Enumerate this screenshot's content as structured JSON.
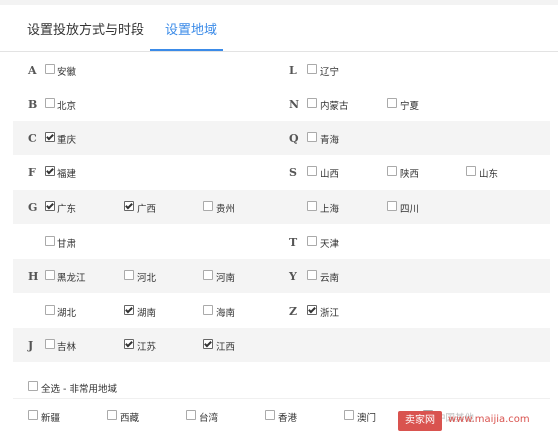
{
  "tabs": [
    {
      "label": "设置投放方式与时段",
      "active": false
    },
    {
      "label": "设置地域",
      "active": true
    }
  ],
  "letters": [
    "A",
    "B",
    "C",
    "F",
    "G",
    "H",
    "J",
    "L",
    "N",
    "Q",
    "S",
    "T",
    "Y",
    "Z"
  ],
  "regions": [
    {
      "name": "安徽",
      "checked": false
    },
    {
      "name": "北京",
      "checked": false
    },
    {
      "name": "重庆",
      "checked": true
    },
    {
      "name": "福建",
      "checked": true
    },
    {
      "name": "广东",
      "checked": true
    },
    {
      "name": "广西",
      "checked": true
    },
    {
      "name": "贵州",
      "checked": false
    },
    {
      "name": "甘肃",
      "checked": false
    },
    {
      "name": "黑龙江",
      "checked": false
    },
    {
      "name": "河北",
      "checked": false
    },
    {
      "name": "河南",
      "checked": false
    },
    {
      "name": "湖北",
      "checked": false
    },
    {
      "name": "湖南",
      "checked": true
    },
    {
      "name": "海南",
      "checked": false
    },
    {
      "name": "吉林",
      "checked": false
    },
    {
      "name": "江苏",
      "checked": true
    },
    {
      "name": "江西",
      "checked": true
    },
    {
      "name": "辽宁",
      "checked": false
    },
    {
      "name": "内蒙古",
      "checked": false
    },
    {
      "name": "宁夏",
      "checked": false
    },
    {
      "name": "青海",
      "checked": false
    },
    {
      "name": "山西",
      "checked": false
    },
    {
      "name": "陕西",
      "checked": false
    },
    {
      "name": "山东",
      "checked": false
    },
    {
      "name": "上海",
      "checked": false
    },
    {
      "name": "四川",
      "checked": false
    },
    {
      "name": "天津",
      "checked": false
    },
    {
      "name": "云南",
      "checked": false
    },
    {
      "name": "浙江",
      "checked": true
    }
  ],
  "select_all_uncommon": {
    "label": "全选 - 非常用地域",
    "checked": false
  },
  "uncommon": [
    {
      "name": "新疆",
      "checked": false
    },
    {
      "name": "西藏",
      "checked": false
    },
    {
      "name": "台湾",
      "checked": false
    },
    {
      "name": "香港",
      "checked": false
    },
    {
      "name": "澳门",
      "checked": false
    },
    {
      "name": "中国其他",
      "checked": false
    }
  ],
  "watermark": {
    "badge": "卖家网",
    "text": "www.maijia.com"
  },
  "colors": {
    "accent": "#3b8be8",
    "row_bg": "#f4f4f4",
    "watermark": "#d9534f"
  }
}
